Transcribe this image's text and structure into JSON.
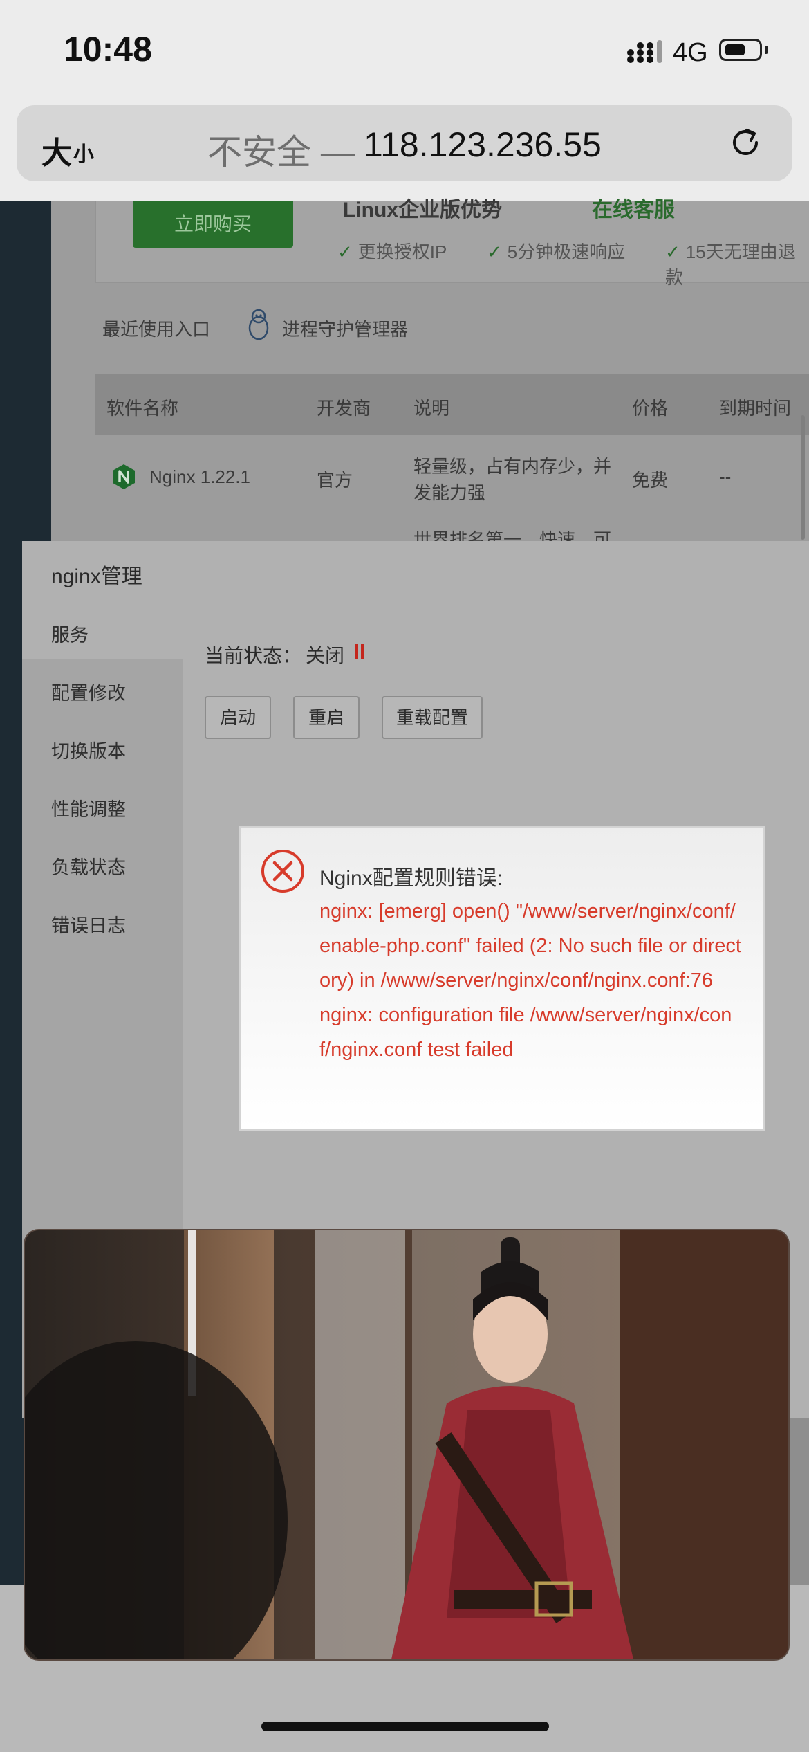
{
  "status_bar": {
    "time": "10:48",
    "network": "4G"
  },
  "browser": {
    "text_size_big": "大",
    "text_size_small": "小",
    "insecure_label": "不安全 —",
    "address": "118.123.236.55"
  },
  "promo": {
    "buy_label": "立即购买",
    "title": "Linux企业版优势",
    "online_service": "在线客服",
    "perks": [
      "更换授权IP",
      "5分钟极速响应",
      "15天无理由退款"
    ]
  },
  "recent": {
    "label": "最近使用入口",
    "guard_manager": "进程守护管理器"
  },
  "software_table": {
    "headers": [
      "软件名称",
      "开发商",
      "说明",
      "价格",
      "到期时间"
    ],
    "rows": [
      {
        "name": "Nginx 1.22.1",
        "vendor": "官方",
        "desc_line1": "轻量级，占有内存少，并",
        "desc_line2": "发能力强",
        "price": "免费",
        "expire": "--"
      },
      {
        "desc_line1": "世界排名第一，快速，可"
      }
    ]
  },
  "panel": {
    "title": "nginx管理",
    "menu": [
      "服务",
      "配置修改",
      "切换版本",
      "性能调整",
      "负载状态",
      "错误日志"
    ],
    "status_label": "当前状态：",
    "status_value": "关闭",
    "buttons": {
      "start": "启动",
      "restart": "重启",
      "reload": "重载配置"
    }
  },
  "error_dialog": {
    "title": "Nginx配置规则错误:",
    "body": "nginx: [emerg] open() \"/www/server/nginx/conf/enable-php.conf\" failed (2: No such file or directory) in /www/server/nginx/conf/nginx.conf:76\nnginx: configuration file /www/server/nginx/conf/nginx.conf test failed"
  },
  "colors": {
    "error_red": "#d73b2b",
    "brand_green": "#28702c",
    "status_stop_red": "#c4261d"
  }
}
